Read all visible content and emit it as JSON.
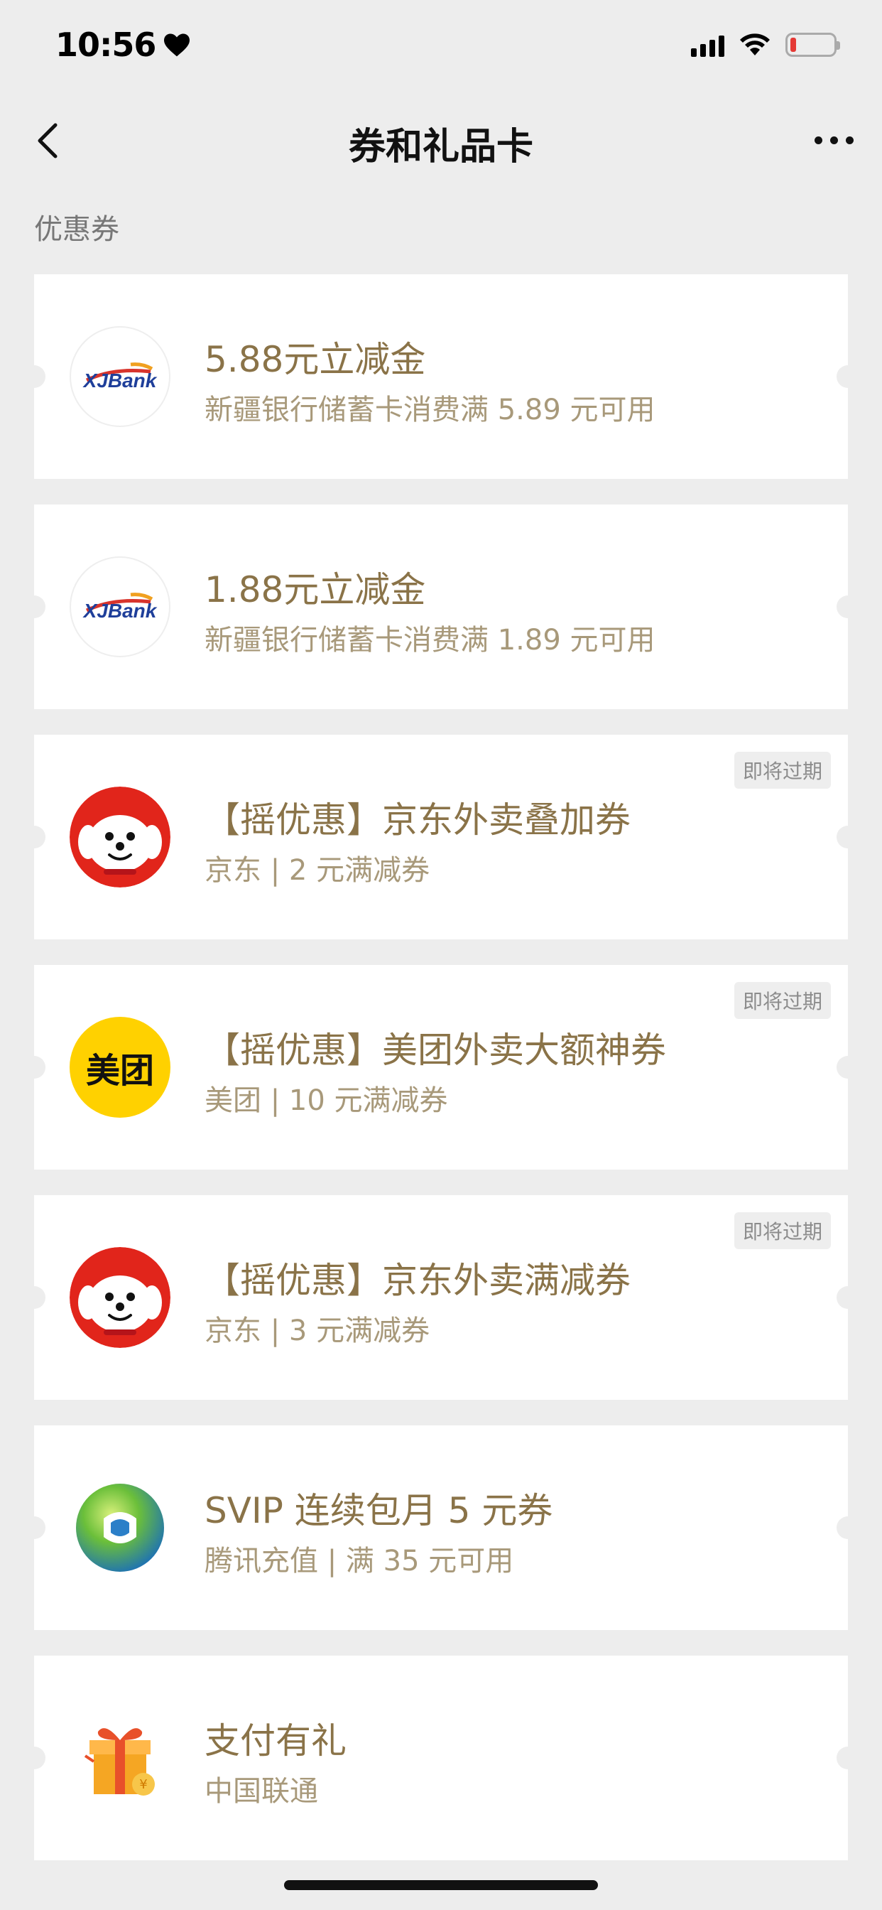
{
  "status_bar": {
    "time": "10:56"
  },
  "nav": {
    "title": "券和礼品卡"
  },
  "section": {
    "title": "优惠券"
  },
  "logo_text": {
    "xjbank": "XJBank",
    "meituan": "美团"
  },
  "cards": [
    {
      "title": "5.88元立减金",
      "subtitle": "新疆银行储蓄卡消费满 5.89 元可用",
      "logo": "xjbank-logo",
      "badge": ""
    },
    {
      "title": "1.88元立减金",
      "subtitle": "新疆银行储蓄卡消费满 1.89 元可用",
      "logo": "xjbank-logo",
      "badge": ""
    },
    {
      "title": "【摇优惠】京东外卖叠加券",
      "subtitle": "京东 | 2 元满减券",
      "logo": "jd-logo",
      "badge": "即将过期"
    },
    {
      "title": "【摇优惠】美团外卖大额神券",
      "subtitle": "美团 | 10 元满减券",
      "logo": "meituan-logo",
      "badge": "即将过期"
    },
    {
      "title": "【摇优惠】京东外卖满减券",
      "subtitle": "京东 | 3 元满减券",
      "logo": "jd-logo",
      "badge": "即将过期"
    },
    {
      "title": "SVIP 连续包月 5 元券",
      "subtitle": "腾讯充值 | 满 35 元可用",
      "logo": "tencent-recharge-logo",
      "badge": ""
    },
    {
      "title": "支付有礼",
      "subtitle": "中国联通",
      "logo": "gift-box-logo",
      "badge": ""
    }
  ],
  "colors": {
    "title": "#8a7348",
    "subtitle": "#a8997a",
    "background": "#ededed",
    "jd_red": "#e1251b",
    "meituan_yellow": "#ffd100"
  }
}
